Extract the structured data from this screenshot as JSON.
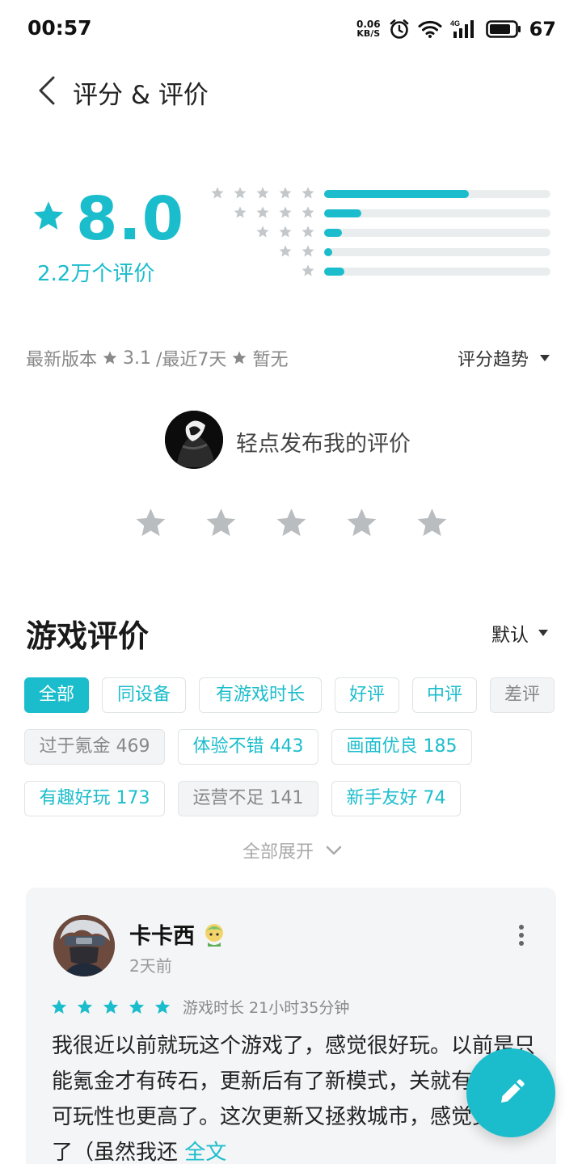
{
  "status_bar": {
    "time": "00:57",
    "net_speed_value": "0.06",
    "net_speed_unit": "KB/S",
    "network_label": "4G",
    "battery": "67"
  },
  "header": {
    "title": "评分 & 评价"
  },
  "rating": {
    "score": "8.0",
    "count_label": "2.2万个评价",
    "distribution": [
      {
        "stars": 5,
        "fraction": 0.64
      },
      {
        "stars": 4,
        "fraction": 0.165
      },
      {
        "stars": 3,
        "fraction": 0.08
      },
      {
        "stars": 2,
        "fraction": 0.035
      },
      {
        "stars": 1,
        "fraction": 0.09
      }
    ],
    "accent_color": "#1bbdcc"
  },
  "version_row": {
    "latest_label": "最新版本",
    "latest_score": "3.1",
    "recent_label": "/最近7天",
    "recent_score": "暂无",
    "trend_label": "评分趋势"
  },
  "my_review": {
    "prompt": "轻点发布我的评价",
    "star_count": 5
  },
  "reviews_section": {
    "title": "游戏评价",
    "sort_label": "默认",
    "filters": [
      {
        "label": "全部",
        "state": "active"
      },
      {
        "label": "同设备",
        "state": "normal"
      },
      {
        "label": "有游戏时长",
        "state": "normal"
      },
      {
        "label": "好评",
        "state": "normal"
      },
      {
        "label": "中评",
        "state": "normal"
      },
      {
        "label": "差评",
        "state": "gray"
      }
    ],
    "tags": [
      {
        "label": "过于氪金 469",
        "state": "gray"
      },
      {
        "label": "体验不错 443",
        "state": "normal"
      },
      {
        "label": "画面优良 185",
        "state": "normal"
      },
      {
        "label": "有趣好玩 173",
        "state": "normal"
      },
      {
        "label": "运营不足 141",
        "state": "gray"
      },
      {
        "label": "新手友好 74",
        "state": "normal"
      }
    ],
    "expand_label": "全部展开"
  },
  "review": {
    "author": "卡卡西",
    "time": "2天前",
    "stars": 5,
    "playtime": "游戏时长 21小时35分钟",
    "text": "我很近以前就玩这个游戏了，感觉很好玩。以前是只能氪金才有砖石，更新后有了新模式，关就有砖石，可玩性也更高了。这次更新又拯救城市，感觉更好玩了（虽然我还",
    "more_label": "全文"
  },
  "fab": {
    "icon": "pencil-icon"
  }
}
